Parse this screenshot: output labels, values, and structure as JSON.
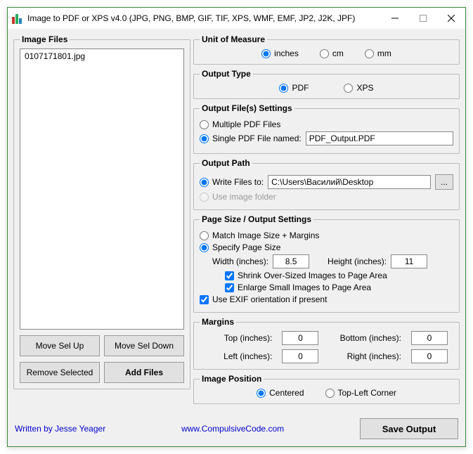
{
  "window": {
    "title": "Image to PDF or XPS  v4.0   (JPG, PNG, BMP, GIF, TIF, XPS, WMF, EMF, JP2, J2K, JPF)"
  },
  "imageFiles": {
    "legend": "Image Files",
    "items": [
      "0107171801.jpg"
    ],
    "moveUp": "Move Sel Up",
    "moveDown": "Move Sel Down",
    "remove": "Remove Selected",
    "add": "Add Files"
  },
  "unit": {
    "legend": "Unit of Measure",
    "inches": "inches",
    "cm": "cm",
    "mm": "mm",
    "selected": "inches"
  },
  "outputType": {
    "legend": "Output Type",
    "pdf": "PDF",
    "xps": "XPS",
    "selected": "pdf"
  },
  "outputFiles": {
    "legend": "Output File(s) Settings",
    "multiple": "Multiple PDF Files",
    "singleLabel": "Single PDF File named:",
    "singleValue": "PDF_Output.PDF",
    "selected": "single"
  },
  "outputPath": {
    "legend": "Output Path",
    "writeLabel": "Write Files to:",
    "writeValue": "C:\\Users\\Василий\\Desktop",
    "browse": "...",
    "imageFolder": "Use image folder",
    "selected": "write"
  },
  "pageSize": {
    "legend": "Page Size / Output Settings",
    "match": "Match Image Size + Margins",
    "specify": "Specify Page Size",
    "selected": "specify",
    "widthLabel": "Width (inches):",
    "widthValue": "8.5",
    "heightLabel": "Height (inches):",
    "heightValue": "11",
    "shrink": "Shrink Over-Sized Images to Page Area",
    "enlarge": "Enlarge Small Images to Page Area",
    "exif": "Use EXIF orientation if present"
  },
  "margins": {
    "legend": "Margins",
    "topLabel": "Top (inches):",
    "topValue": "0",
    "bottomLabel": "Bottom (inches):",
    "bottomValue": "0",
    "leftLabel": "Left (inches):",
    "leftValue": "0",
    "rightLabel": "Right (inches):",
    "rightValue": "0"
  },
  "imagePosition": {
    "legend": "Image Position",
    "centered": "Centered",
    "topLeft": "Top-Left Corner",
    "selected": "centered"
  },
  "footer": {
    "author": "Written by Jesse Yeager",
    "site": "www.CompulsiveCode.com",
    "save": "Save Output"
  }
}
